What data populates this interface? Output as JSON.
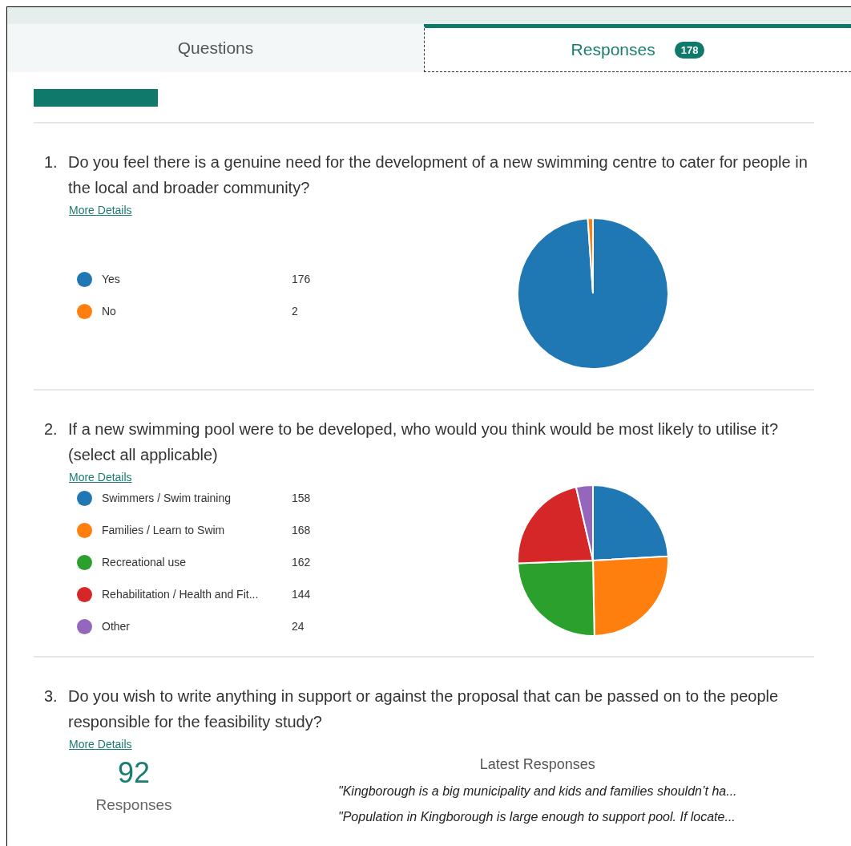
{
  "tabs": [
    {
      "label": "Questions",
      "selected": false
    },
    {
      "label": "Responses",
      "selected": true,
      "badge": "178"
    }
  ],
  "questions": [
    {
      "number": "1.",
      "text": "Do you feel there is a genuine need for the development of a new swimming centre to cater for people in the local and broader community?",
      "link": "More Details",
      "kind": "choice",
      "options": [
        {
          "label": "Yes",
          "count": "176",
          "color": "#1f77b4"
        },
        {
          "label": "No",
          "count": "2",
          "color": "#ff7f0e"
        }
      ],
      "chart_data": {
        "type": "pie",
        "values": [
          98.9,
          1.1
        ]
      }
    },
    {
      "number": "2.",
      "text": "If a new swimming pool were to be developed, who would you think would be most likely to utilise it? (select all applicable)",
      "link": "More Details",
      "kind": "choice",
      "options": [
        {
          "label": "Swimmers / Swim training",
          "count": "158",
          "color": "#1f77b4"
        },
        {
          "label": "Families / Learn to Swim",
          "count": "168",
          "color": "#ff7f0e"
        },
        {
          "label": "Recreational use",
          "count": "162",
          "color": "#2ca02c"
        },
        {
          "label": "Rehabilitation / Health and Fit...",
          "count": "144",
          "color": "#d62728"
        },
        {
          "label": "Other",
          "count": "24",
          "color": "#9467bd"
        }
      ],
      "chart_data": {
        "type": "pie",
        "values": [
          24.1,
          25.6,
          24.7,
          22.0,
          3.6
        ]
      }
    },
    {
      "number": "3.",
      "text": "Do you wish to write anything in support or against the proposal that can be passed on to the people responsible for the feasibility study?",
      "link": "More Details",
      "kind": "text",
      "total": "92",
      "total_label": "Responses",
      "latest_title": "Latest Responses",
      "latest": [
        "\"Kingborough is a big municipality and kids and families shouldn’t ha...",
        "\"Population in Kingborough is large enough to support pool. If locate..."
      ]
    }
  ]
}
